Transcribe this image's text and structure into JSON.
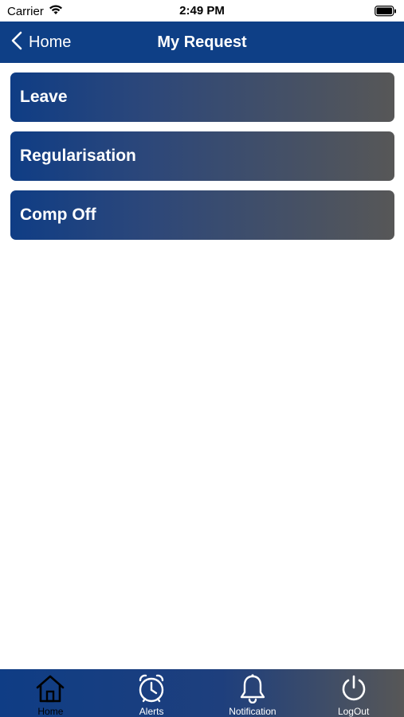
{
  "status_bar": {
    "carrier": "Carrier",
    "time": "2:49 PM",
    "wifi_icon": "wifi-icon",
    "battery_icon": "battery-icon"
  },
  "nav": {
    "back_label": "Home",
    "back_icon": "chevron-left-icon",
    "title": "My Request",
    "color": "#0e3f86"
  },
  "menu": {
    "items": [
      {
        "label": "Leave"
      },
      {
        "label": "Regularisation"
      },
      {
        "label": "Comp Off"
      }
    ]
  },
  "tab_bar": {
    "tabs": [
      {
        "label": "Home",
        "icon": "home-icon",
        "active": true
      },
      {
        "label": "Alerts",
        "icon": "alarm-clock-icon",
        "active": false
      },
      {
        "label": "Notification",
        "icon": "bell-icon",
        "active": false
      },
      {
        "label": "LogOut",
        "icon": "power-icon",
        "active": false
      }
    ]
  },
  "colors": {
    "brand_blue": "#0f3d85",
    "gradient_end": "#575757"
  }
}
